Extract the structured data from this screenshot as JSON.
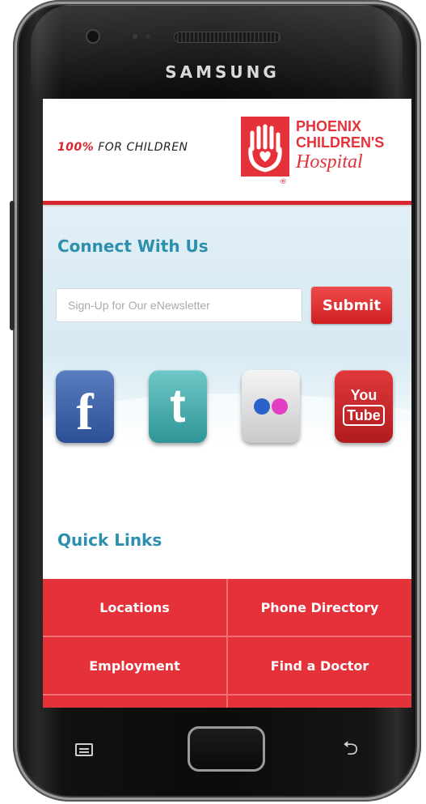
{
  "device": {
    "brand": "SAMSUNG"
  },
  "header": {
    "tagline_pct": "100%",
    "tagline_rest": "FOR CHILDREN",
    "logo_line1": "PHOENIX",
    "logo_line2": "CHILDREN'S",
    "logo_line3": "Hospital",
    "logo_mark": "®"
  },
  "connect": {
    "title": "Connect With Us",
    "newsletter_placeholder": "Sign-Up for Our eNewsletter",
    "submit_label": "Submit",
    "social": [
      {
        "name": "facebook",
        "glyph": "f"
      },
      {
        "name": "twitter",
        "glyph": "t"
      },
      {
        "name": "flickr",
        "glyph": ""
      },
      {
        "name": "youtube",
        "glyph_top": "You",
        "glyph_bottom": "Tube"
      }
    ]
  },
  "quick_links": {
    "title": "Quick Links",
    "items": [
      "Locations",
      "Phone Directory",
      "Employment",
      "Find a Doctor",
      "",
      ""
    ]
  },
  "colors": {
    "brand_red": "#e5323a",
    "heading_teal": "#2b8fae"
  }
}
